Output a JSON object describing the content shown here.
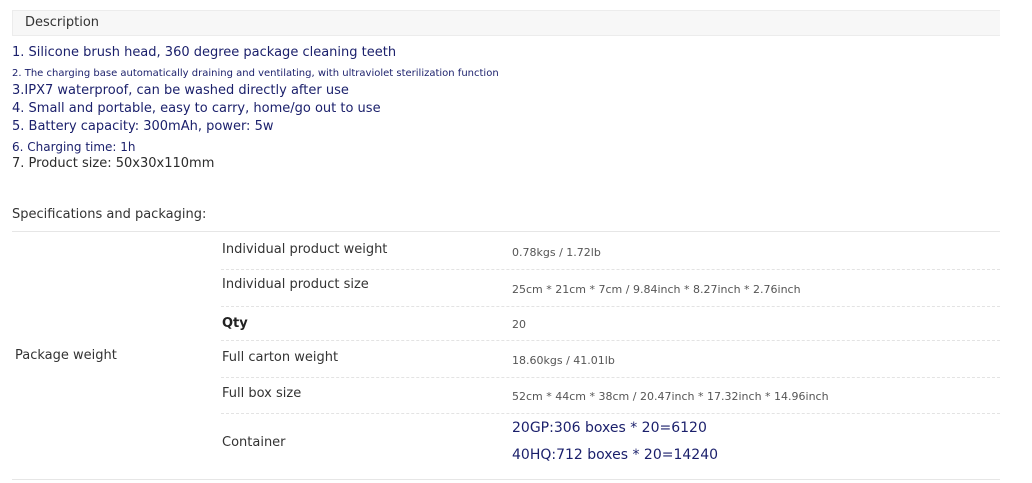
{
  "description": {
    "header": "Description",
    "lines": [
      "1. Silicone brush head, 360 degree package cleaning teeth",
      "2. The charging base automatically draining and ventilating, with ultraviolet sterilization function",
      "3.IPX7 waterproof, can be washed directly after use",
      "4. Small and portable, easy to carry, home/go out to use",
      "5. Battery capacity: 300mAh, power: 5w",
      "6. Charging time: 1h",
      "7. Product size: 50x30x110mm"
    ]
  },
  "specs": {
    "title": "Specifications and packaging:",
    "group_label": "Package weight",
    "rows": [
      {
        "key": "Individual product weight",
        "value": "0.78kgs / 1.72lb"
      },
      {
        "key": "Individual product size",
        "value": "25cm * 21cm * 7cm / 9.84inch * 8.27inch * 2.76inch"
      },
      {
        "key": "Qty",
        "value": "20"
      },
      {
        "key": "Full carton weight",
        "value": "18.60kgs / 41.01lb"
      },
      {
        "key": "Full box size",
        "value": "52cm * 44cm * 38cm / 20.47inch * 17.32inch * 14.96inch"
      },
      {
        "key": "Container",
        "values": [
          "20GP:306 boxes * 20=6120",
          "40HQ:712 boxes * 20=14240"
        ]
      }
    ]
  },
  "colors": {
    "accent_text": "#1a1f6b",
    "header_bg": "#f7f7f7",
    "border": "#e6e6e6"
  }
}
